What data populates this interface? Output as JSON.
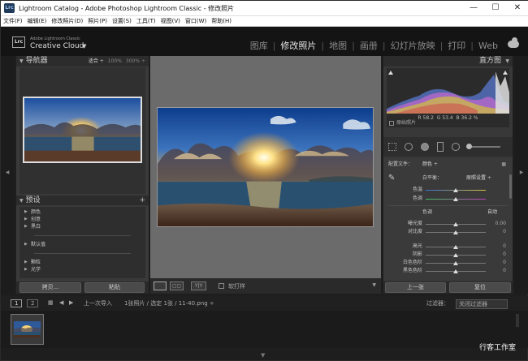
{
  "window": {
    "title": "Lightroom Catalog - Adobe Photoshop Lightroom Classic - 修改照片",
    "app_icon_text": "Lrc",
    "minimize": "—",
    "maximize": "☐",
    "close": "✕"
  },
  "menu": [
    "文件(F)",
    "编辑(E)",
    "修改照片(D)",
    "照片(P)",
    "设置(S)",
    "工具(T)",
    "视图(V)",
    "窗口(W)",
    "帮助(H)"
  ],
  "identity": {
    "logo": "Lrc",
    "brand_small": "Adobe Lightroom Classic",
    "brand_large": "Creative Cloud",
    "caret": "▼",
    "modules": [
      "图库",
      "修改照片",
      "地图",
      "画册",
      "幻灯片放映",
      "打印",
      "Web"
    ],
    "active_module": "修改照片"
  },
  "navigator": {
    "title": "导航器",
    "zoom_fit": "适合 ÷",
    "zoom_100": "100%",
    "zoom_300": "300% ÷"
  },
  "presets": {
    "title": "预设",
    "add": "+",
    "items": [
      "颜色",
      "创意",
      "黑白",
      "默认值",
      "颗粒",
      "光学"
    ]
  },
  "left_buttons": {
    "copy": "拷贝...",
    "paste": "粘贴"
  },
  "toolbar": {
    "view_xy": "Y|Y",
    "softproof_label": "软打样"
  },
  "histogram": {
    "title": "直方图",
    "r_label": "R",
    "r_value": "58.2",
    "g_label": "G",
    "g_value": "53.4",
    "b_label": "B",
    "b_value": "36.2",
    "percent": "%",
    "original_label": "原始照片"
  },
  "basic": {
    "profile_label": "配置文件：",
    "profile_value": "颜色 ÷",
    "wb_label": "白平衡：",
    "wb_value": "原照设置 ÷",
    "temp_label": "色温",
    "tint_label": "色调",
    "tone_label": "色调",
    "auto_label": "自动",
    "exposure_label": "曝光度",
    "exposure_value": "0.00",
    "contrast_label": "对比度",
    "contrast_value": "0",
    "highlights_label": "高光",
    "highlights_value": "0",
    "shadows_label": "阴影",
    "shadows_value": "0",
    "whites_label": "白色色阶",
    "whites_value": "0",
    "blacks_label": "黑色色阶",
    "blacks_value": "0"
  },
  "right_buttons": {
    "previous": "上一张",
    "reset": "复位"
  },
  "filmstrip_bar": {
    "page1": "1",
    "page2": "2",
    "source": "上一次导入",
    "info": "1张照片 / 选定 1张 / 11-40.png ÷",
    "filter_label": "过滤器：",
    "filter_value": "关闭过滤器"
  },
  "watermark": "行客工作室",
  "colors": {
    "accent": "#e6e6e6",
    "panel": "#3a3a3a",
    "canvas": "#6b6b6b"
  }
}
